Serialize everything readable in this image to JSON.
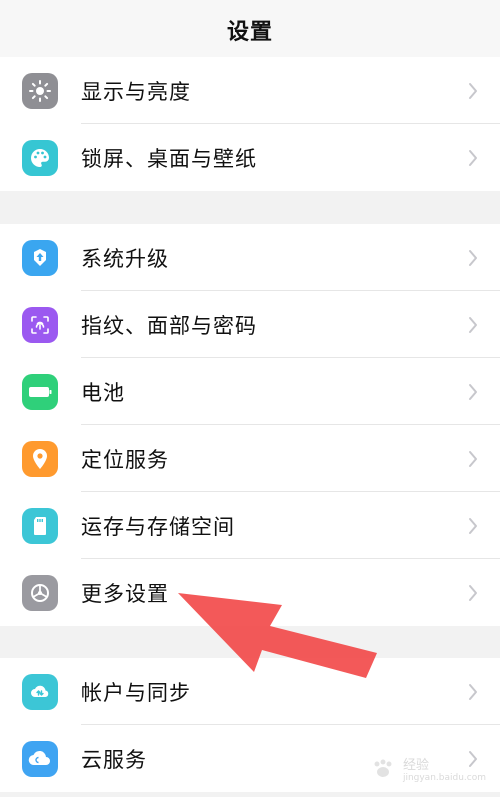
{
  "header": {
    "title": "设置"
  },
  "groups": [
    {
      "items": [
        {
          "label": "显示与亮度",
          "icon": "sun-icon",
          "color": "#8f8f94"
        },
        {
          "label": "锁屏、桌面与壁纸",
          "icon": "palette-icon",
          "color": "#36c6d3"
        }
      ]
    },
    {
      "items": [
        {
          "label": "系统升级",
          "icon": "system-update-icon",
          "color": "#3aa6f0"
        },
        {
          "label": "指纹、面部与密码",
          "icon": "fingerprint-icon",
          "color": "#9b59f0"
        },
        {
          "label": "电池",
          "icon": "battery-icon",
          "color": "#2fd07a"
        },
        {
          "label": "定位服务",
          "icon": "location-pin-icon",
          "color": "#ff9a2e"
        },
        {
          "label": "运存与存储空间",
          "icon": "sd-card-icon",
          "color": "#3cc6d6"
        },
        {
          "label": "更多设置",
          "icon": "gear-icon",
          "color": "#9a9aa0"
        }
      ]
    },
    {
      "items": [
        {
          "label": "帐户与同步",
          "icon": "account-sync-icon",
          "color": "#3cc6d6"
        },
        {
          "label": "云服务",
          "icon": "cloud-icon",
          "color": "#3fa4f2"
        }
      ]
    }
  ],
  "annotation": {
    "arrow_color": "#f24b4b"
  },
  "watermark": {
    "text": "经验",
    "subtext": "jingyan.baidu.com"
  }
}
